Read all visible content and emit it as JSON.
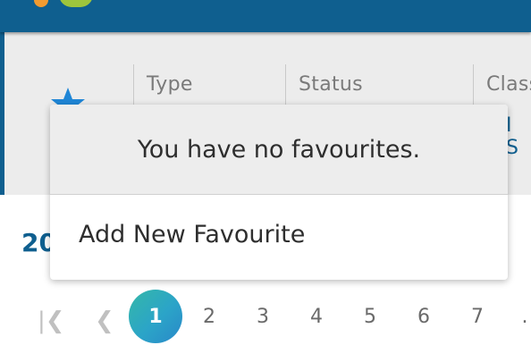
{
  "columns": {
    "type": "Type",
    "status": "Status",
    "class": "Class",
    "class_sub": "I S"
  },
  "heading": "20",
  "favourites": {
    "empty_message": "You have no favourites.",
    "add_label": "Add New Favourite",
    "star_icon": "star-icon"
  },
  "pagination": {
    "current": "1",
    "pages": [
      "2",
      "3",
      "4",
      "5",
      "6",
      "7"
    ],
    "first_icon": "first-page-icon",
    "prev_icon": "prev-page-icon",
    "more": "."
  },
  "colors": {
    "brand": "#0f5f8f",
    "accent_start": "#35b8a8",
    "accent_end": "#2a88c9",
    "star": "#1f86d6"
  }
}
